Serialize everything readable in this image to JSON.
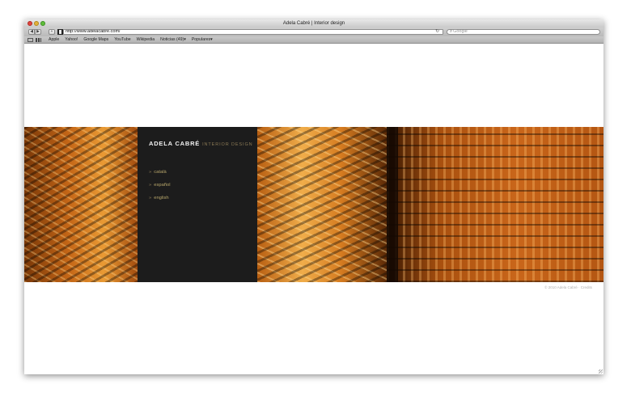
{
  "window": {
    "title": "Adela Cabré | Interior design"
  },
  "toolbar": {
    "back_glyph": "◀",
    "forward_glyph": "▶",
    "add_glyph": "+",
    "url": "http://www.adelacabre.com/",
    "reload_glyph": "↻",
    "search_placeholder": "Google",
    "search_icon_glyph": "⌕"
  },
  "bookmarks": {
    "items": [
      "Apple",
      "Yahoo!",
      "Google Maps",
      "YouTube",
      "Wikipedia",
      "Noticias (49)▾",
      "Populares▾"
    ]
  },
  "page": {
    "brand_name": "ADELA CABRÉ",
    "brand_sub": "INTERIOR DESIGN",
    "lang_arrow": "»",
    "languages": [
      "català",
      "español",
      "english"
    ],
    "copyright": "© 2010 Adela Cabré · Credits"
  },
  "colors": {
    "panel": "#1c1c1c",
    "brand_text": "#f2f2f2",
    "accent_gold": "#b6a56a"
  }
}
